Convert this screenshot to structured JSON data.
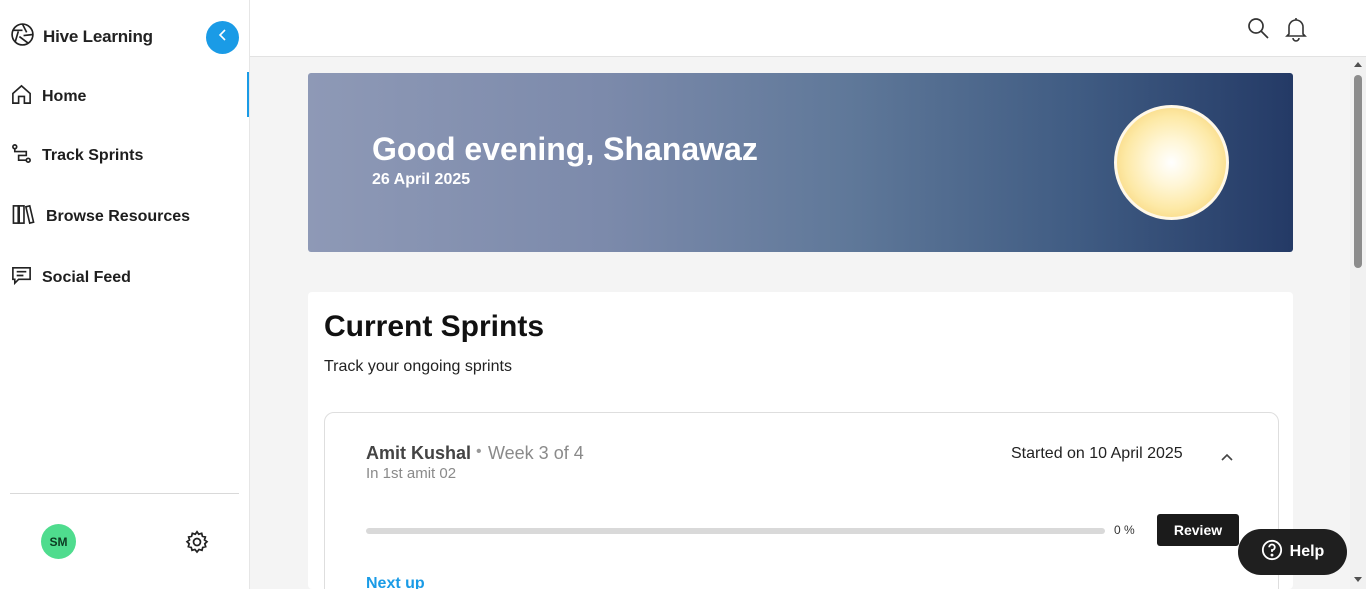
{
  "app": {
    "name": "Hive Learning"
  },
  "sidebar": {
    "items": [
      {
        "label": "Home",
        "icon": "home-icon",
        "active": true
      },
      {
        "label": "Track Sprints",
        "icon": "route-icon"
      },
      {
        "label": "Browse Resources",
        "icon": "books-icon"
      },
      {
        "label": "Social Feed",
        "icon": "chat-icon"
      }
    ],
    "user_initials": "SM",
    "settings_icon": "gear-icon"
  },
  "topbar": {
    "search_icon": "search-icon",
    "notifications_icon": "bell-icon"
  },
  "banner": {
    "greeting": "Good evening, Shanawaz",
    "date": "26 April 2025",
    "illustration": "sun-icon"
  },
  "current_sprints": {
    "title": "Current Sprints",
    "subtitle": "Track your ongoing sprints",
    "sprint": {
      "owner": "Amit Kushal",
      "separator": "•",
      "week": "Week 3 of 4",
      "team": "In 1st amit 02",
      "started": "Started on 10 April 2025",
      "progress_percent": 0,
      "progress_text": "0 %",
      "review_label": "Review",
      "next_up_label": "Next up"
    }
  },
  "help": {
    "label": "Help"
  },
  "colors": {
    "accent": "#1a9be6",
    "avatar": "#4fdc8e",
    "dark_button": "#1b1b1b"
  }
}
